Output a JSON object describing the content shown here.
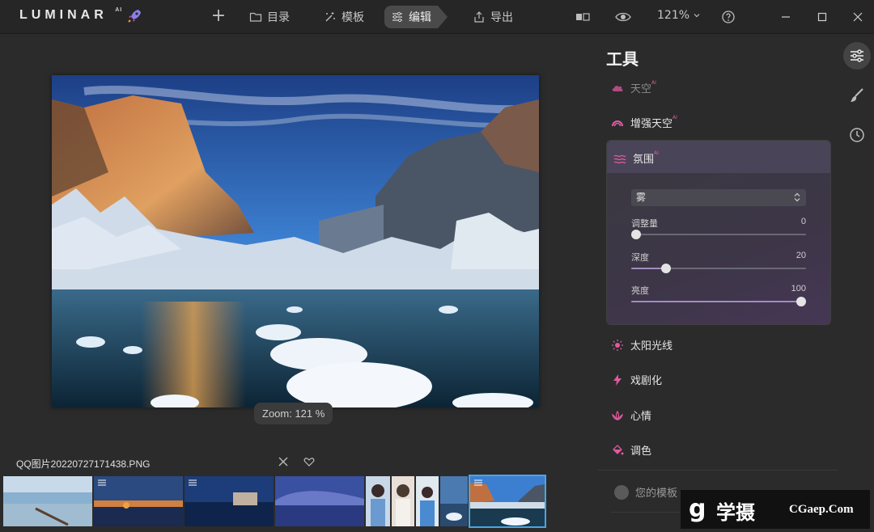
{
  "app": {
    "logo": "LUMINAR",
    "logo_sup": "AI"
  },
  "toolbar": {
    "catalog_label": "目录",
    "templates_label": "模板",
    "edit_label": "编辑",
    "export_label": "导出",
    "zoom_label": "121%"
  },
  "canvas": {
    "zoom_pill": "Zoom: 121 %"
  },
  "filmstrip": {
    "filename": "QQ图片20220727171438.PNG"
  },
  "panel": {
    "title": "工具",
    "tools": {
      "sky": "天空",
      "sky_enhancer": "增强天空",
      "atmosphere": "氛围",
      "sunrays": "太阳光线",
      "dramatic": "戏剧化",
      "mood": "心情",
      "toning": "调色"
    },
    "ai_badge": "AI",
    "atmosphere_panel": {
      "type_selected": "雾",
      "sliders": [
        {
          "label": "调整量",
          "value": "0",
          "fraction": 0.0
        },
        {
          "label": "深度",
          "value": "20",
          "fraction": 0.2
        },
        {
          "label": "亮度",
          "value": "100",
          "fraction": 1.0
        }
      ]
    },
    "your_templates": "您的模板"
  },
  "watermark": {
    "cn": "学摄",
    "url": "CGaep.Com"
  },
  "colors": {
    "accent_pink": "#e05aa0",
    "selection_blue": "#4aa6e0"
  }
}
